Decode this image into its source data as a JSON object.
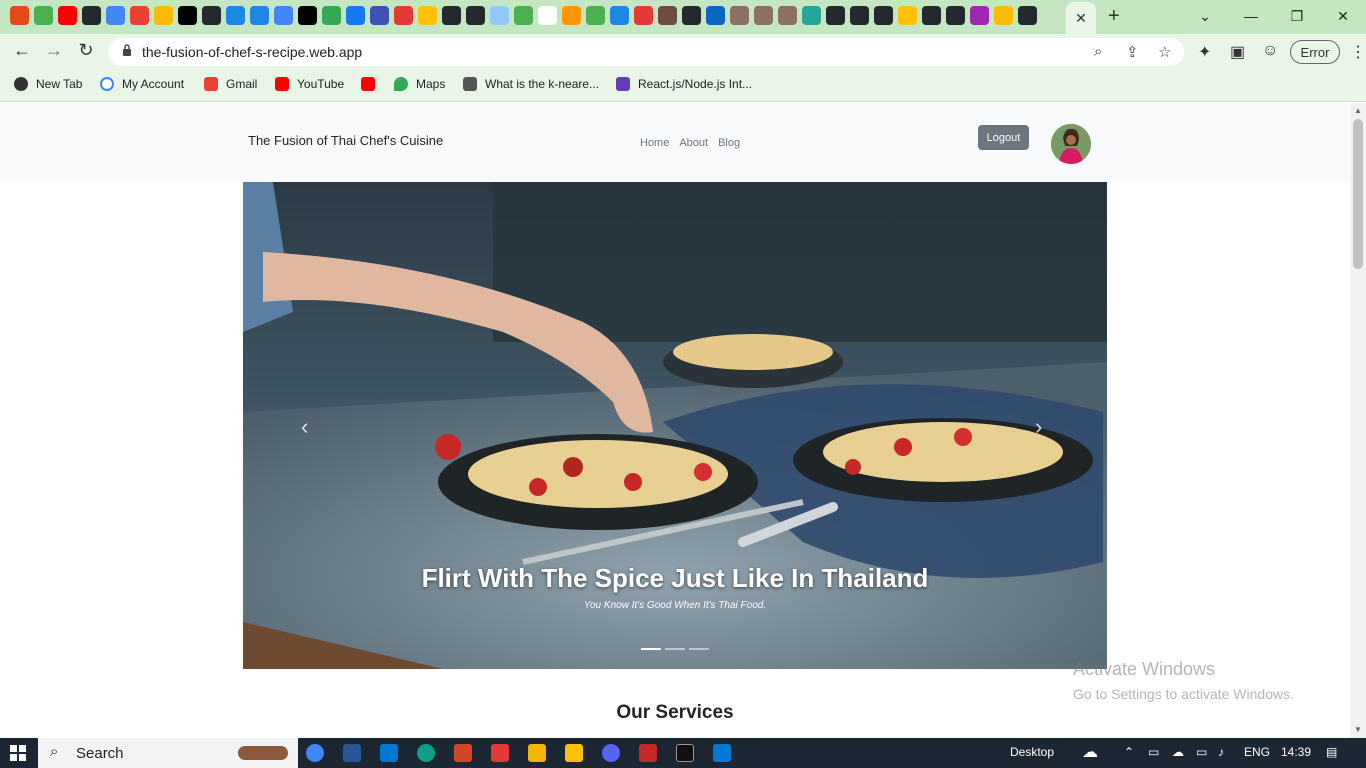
{
  "browser": {
    "url": "the-fusion-of-chef-s-recipe.web.app",
    "profile_status": "Error",
    "bookmarks": [
      {
        "label": "New Tab",
        "icon": "globe-icon"
      },
      {
        "label": "My Account",
        "icon": "google-icon"
      },
      {
        "label": "Gmail",
        "icon": "gmail-icon"
      },
      {
        "label": "YouTube",
        "icon": "youtube-icon"
      },
      {
        "label": "",
        "icon": "youtube-icon"
      },
      {
        "label": "Maps",
        "icon": "maps-icon"
      },
      {
        "label": "What is the k-neare...",
        "icon": "scholar-icon"
      },
      {
        "label": "React.js/Node.js Int...",
        "icon": "doc-icon"
      }
    ],
    "tab_icons": [
      "#e64a19",
      "#4caf50",
      "#ff0000",
      "#24292e",
      "#4285f4",
      "#ea4335",
      "#fbbc05",
      "#000000",
      "#24292e",
      "#1e88e5",
      "#1e88e5",
      "#4285f4",
      "#000000",
      "#34a853",
      "#1877f2",
      "#3f51b5",
      "#e53935",
      "#ffc107",
      "#24292e",
      "#24292e",
      "#90caf9",
      "#4caf50",
      "#ffffff",
      "#ff9800",
      "#4caf50",
      "#1e88e5",
      "#e53935",
      "#6d4c41",
      "#24292e",
      "#0a66c2",
      "#8d6e63",
      "#8d6e63",
      "#8d6e63",
      "#26a69a",
      "#24292e",
      "#24292e",
      "#24292e",
      "#ffc107",
      "#24292e",
      "#24292e",
      "#9c27b0",
      "#fbbc05",
      "#24292e"
    ]
  },
  "site": {
    "brand": "The Fusion of Thai Chef's Cuisine",
    "nav": [
      "Home",
      "About",
      "Blog"
    ],
    "logout_label": "Logout",
    "carousel": {
      "title": "Flirt With The Spice Just Like In Thailand",
      "subtitle": "You Know It's Good When It's Thai Food.",
      "slides": 3,
      "active_slide": 1
    },
    "section_title": "Our Services"
  },
  "watermark": {
    "line1": "Activate Windows",
    "line2": "Go to Settings to activate Windows."
  },
  "taskbar": {
    "search_label": "Search",
    "desktop_label": "Desktop",
    "lang": "ENG",
    "time": "14:39"
  }
}
